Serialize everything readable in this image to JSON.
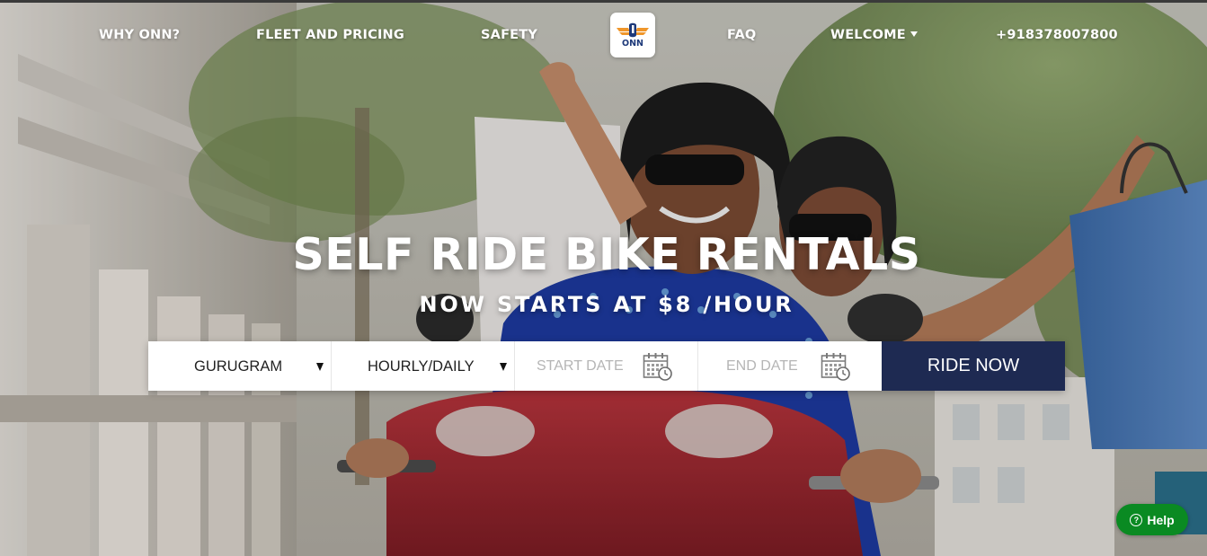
{
  "nav": {
    "why_onn": "WHY ONN?",
    "fleet_pricing": "FLEET AND PRICING",
    "safety": "SAFETY",
    "logo_text": "ONN",
    "faq": "FAQ",
    "welcome": "WELCOME",
    "phone": "+918378007800"
  },
  "hero": {
    "headline": "SELF RIDE BIKE RENTALS",
    "subheadline": "NOW STARTS AT $8 /HOUR"
  },
  "booking": {
    "city": {
      "value": "GURUGRAM",
      "icon": "caret-down-icon"
    },
    "rental_type": {
      "value": "HOURLY/DAILY",
      "icon": "caret-down-icon"
    },
    "start_date": {
      "placeholder": "START DATE",
      "icon": "calendar-icon"
    },
    "end_date": {
      "placeholder": "END DATE",
      "icon": "calendar-icon"
    },
    "submit_label": "RIDE NOW"
  },
  "help": {
    "label": "Help",
    "icon": "question-circle-icon"
  },
  "colors": {
    "ride_button": "#1e2a52",
    "help_button": "#0a8a22",
    "logo_blue": "#1e3a7a",
    "logo_orange": "#f0962a"
  }
}
